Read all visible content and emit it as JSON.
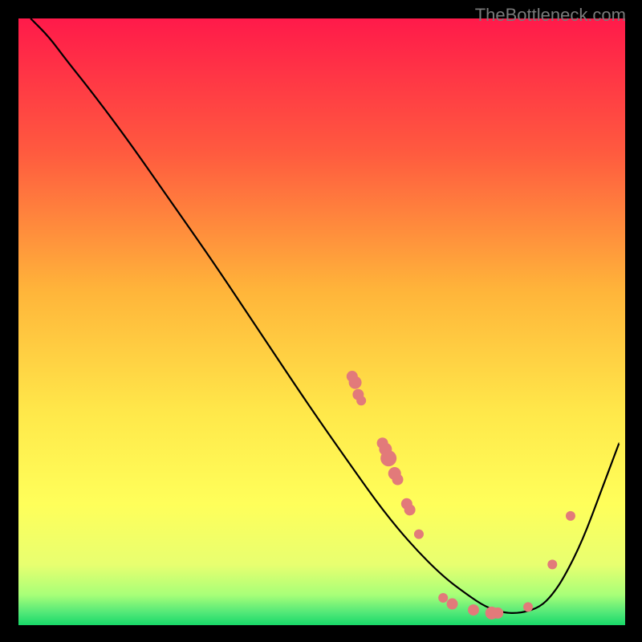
{
  "watermark": "TheBottleneck.com",
  "colors": {
    "top": "#ff1a4a",
    "upper_mid": "#ff6a3a",
    "mid": "#ffd23a",
    "lower_mid": "#ffff5a",
    "near_bottom": "#d8ff7a",
    "bottom": "#20e070",
    "curve": "#000000",
    "point_fill": "#e27a7a",
    "point_stroke": "#c95858",
    "background": "#000000"
  },
  "chart_data": {
    "type": "line",
    "title": "",
    "xlabel": "",
    "ylabel": "",
    "xlim": [
      0,
      100
    ],
    "ylim": [
      0,
      100
    ],
    "series": [
      {
        "name": "curve",
        "x": [
          2,
          5,
          8,
          12,
          18,
          25,
          32,
          40,
          48,
          55,
          60,
          65,
          70,
          74,
          77,
          80,
          83,
          86,
          88,
          90,
          93,
          96,
          99
        ],
        "y": [
          100,
          97,
          93,
          88,
          80,
          70,
          60,
          48,
          36,
          26,
          19,
          13,
          8,
          5,
          3,
          2,
          2,
          3,
          5,
          8,
          14,
          22,
          30
        ]
      }
    ],
    "scatter_points": [
      {
        "x": 55,
        "y": 41,
        "r": 7
      },
      {
        "x": 55.5,
        "y": 40,
        "r": 8
      },
      {
        "x": 56,
        "y": 38,
        "r": 7
      },
      {
        "x": 56.5,
        "y": 37,
        "r": 6
      },
      {
        "x": 60,
        "y": 30,
        "r": 7
      },
      {
        "x": 60.5,
        "y": 29,
        "r": 8
      },
      {
        "x": 61,
        "y": 27.5,
        "r": 10
      },
      {
        "x": 62,
        "y": 25,
        "r": 8
      },
      {
        "x": 62.5,
        "y": 24,
        "r": 7
      },
      {
        "x": 64,
        "y": 20,
        "r": 7
      },
      {
        "x": 64.5,
        "y": 19,
        "r": 7
      },
      {
        "x": 66,
        "y": 15,
        "r": 6
      },
      {
        "x": 70,
        "y": 4.5,
        "r": 6
      },
      {
        "x": 71.5,
        "y": 3.5,
        "r": 7
      },
      {
        "x": 75,
        "y": 2.5,
        "r": 7
      },
      {
        "x": 78,
        "y": 2,
        "r": 8
      },
      {
        "x": 79,
        "y": 2,
        "r": 7
      },
      {
        "x": 84,
        "y": 3,
        "r": 6
      },
      {
        "x": 88,
        "y": 10,
        "r": 6
      },
      {
        "x": 91,
        "y": 18,
        "r": 6
      }
    ],
    "gradient_stops": [
      {
        "offset": 0,
        "color": "#ff1a4a"
      },
      {
        "offset": 22,
        "color": "#ff5a3f"
      },
      {
        "offset": 45,
        "color": "#ffb53a"
      },
      {
        "offset": 65,
        "color": "#ffe84a"
      },
      {
        "offset": 80,
        "color": "#ffff5a"
      },
      {
        "offset": 90,
        "color": "#e8ff70"
      },
      {
        "offset": 95,
        "color": "#a8ff78"
      },
      {
        "offset": 98,
        "color": "#50e878"
      },
      {
        "offset": 100,
        "color": "#18d868"
      }
    ]
  }
}
